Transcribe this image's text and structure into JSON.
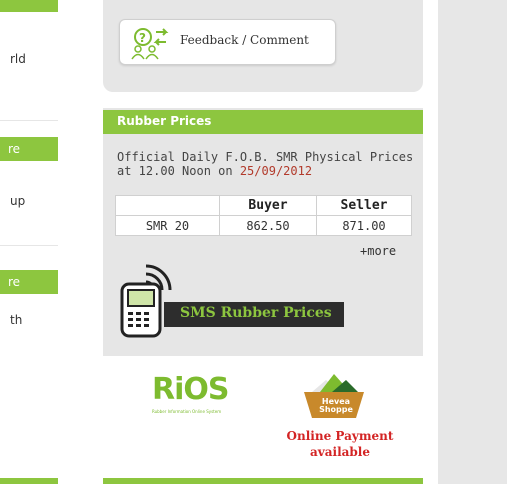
{
  "left_column": {
    "text1": "rld",
    "bar1": "re",
    "text2": "up",
    "bar2": "re",
    "text3": "th"
  },
  "feedback": {
    "label": "Feedback / Comment"
  },
  "rubber_prices": {
    "title": "Rubber Prices",
    "description": "Official Daily F.O.B. SMR Physical Prices at 12.00 Noon on ",
    "date": "25/09/2012",
    "columns": [
      "",
      "Buyer",
      "Seller"
    ],
    "rows": [
      {
        "grade": "SMR 20",
        "buyer": "862.50",
        "seller": "871.00"
      }
    ],
    "more_link": "+more"
  },
  "sms": {
    "label": "SMS Rubber Prices"
  },
  "logos": {
    "rios": "RiOS",
    "rios_tagline": "Rubber Information Online System",
    "heveashoppe": "Hevea Shoppe",
    "online_payment": "Online Payment available"
  },
  "colors": {
    "accent_green": "#8dc63f",
    "date_red": "#b23a2b",
    "payment_red": "#d32424"
  }
}
